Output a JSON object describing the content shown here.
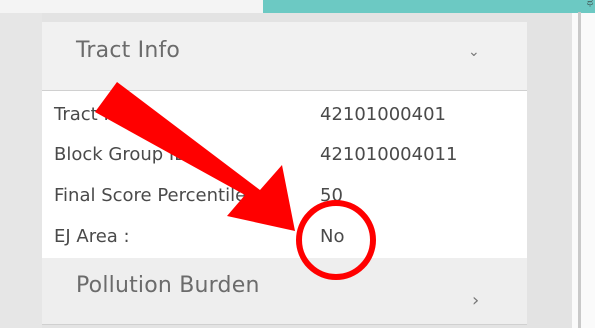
{
  "corner_glyph": "ಥ",
  "tract_info": {
    "title": "Tract Info",
    "chevron": "⌄",
    "rows": [
      {
        "label": "Tract ID :",
        "value": "42101000401"
      },
      {
        "label": "Block Group ID :",
        "value": "421010004011"
      },
      {
        "label": "Final Score Percentile :",
        "value": "50"
      },
      {
        "label": "EJ Area :",
        "value": "No"
      }
    ]
  },
  "pollution_burden": {
    "title": "Pollution Burden",
    "chevron": "›"
  },
  "colors": {
    "teal": "#6cc9c3",
    "annotation_red": "#ff0000"
  }
}
